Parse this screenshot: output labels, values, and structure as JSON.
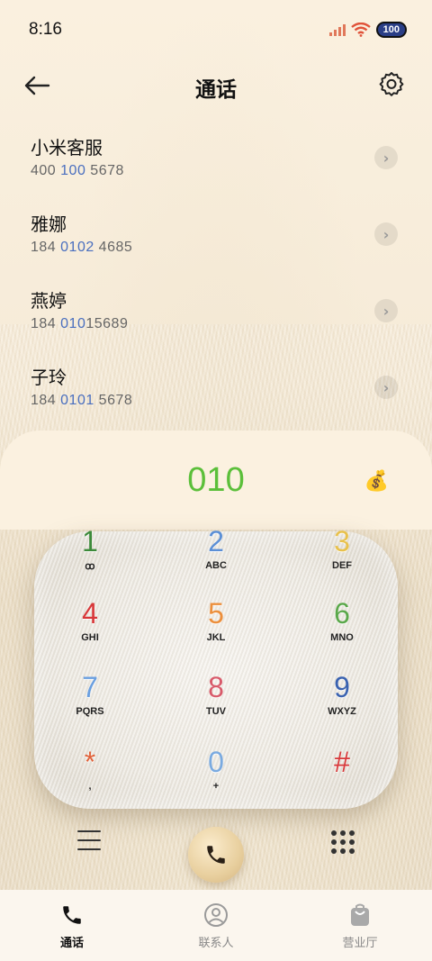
{
  "status_bar": {
    "time": "8:16",
    "battery": "100"
  },
  "header": {
    "title": "通话"
  },
  "contacts": [
    {
      "name": "小米客服",
      "number_parts": [
        "400 ",
        "100",
        " 5678"
      ]
    },
    {
      "name": "雅娜",
      "number_parts": [
        "184 ",
        "0102",
        " 4685"
      ]
    },
    {
      "name": "燕婷",
      "number_parts": [
        "184 ",
        "010",
        "15689"
      ]
    },
    {
      "name": "子玲",
      "number_parts": [
        "184 ",
        "0101",
        " 5678"
      ]
    }
  ],
  "dialer": {
    "number": "010",
    "money_icon": "💰"
  },
  "keypad": [
    {
      "digit": "1",
      "letters": "ꝏ",
      "color": "#3c8a3a"
    },
    {
      "digit": "2",
      "letters": "ABC",
      "color": "#5b8fd6"
    },
    {
      "digit": "3",
      "letters": "DEF",
      "color": "#e8c14c"
    },
    {
      "digit": "4",
      "letters": "GHI",
      "color": "#d8383a"
    },
    {
      "digit": "5",
      "letters": "JKL",
      "color": "#ec8f3c"
    },
    {
      "digit": "6",
      "letters": "MNO",
      "color": "#5aa84a"
    },
    {
      "digit": "7",
      "letters": "PQRS",
      "color": "#6a9fe0"
    },
    {
      "digit": "8",
      "letters": "TUV",
      "color": "#d85a6a"
    },
    {
      "digit": "9",
      "letters": "WXYZ",
      "color": "#3a62b0"
    },
    {
      "digit": "*",
      "letters": ",",
      "color": "#e0623a"
    },
    {
      "digit": "0",
      "letters": "+",
      "color": "#7aaae0"
    },
    {
      "digit": "#",
      "letters": "",
      "color": "#d8383a"
    }
  ],
  "nav": [
    {
      "label": "通话",
      "icon": "phone-icon",
      "active": true
    },
    {
      "label": "联系人",
      "icon": "contact-icon",
      "active": false
    },
    {
      "label": "营业厅",
      "icon": "bag-icon",
      "active": false
    }
  ]
}
